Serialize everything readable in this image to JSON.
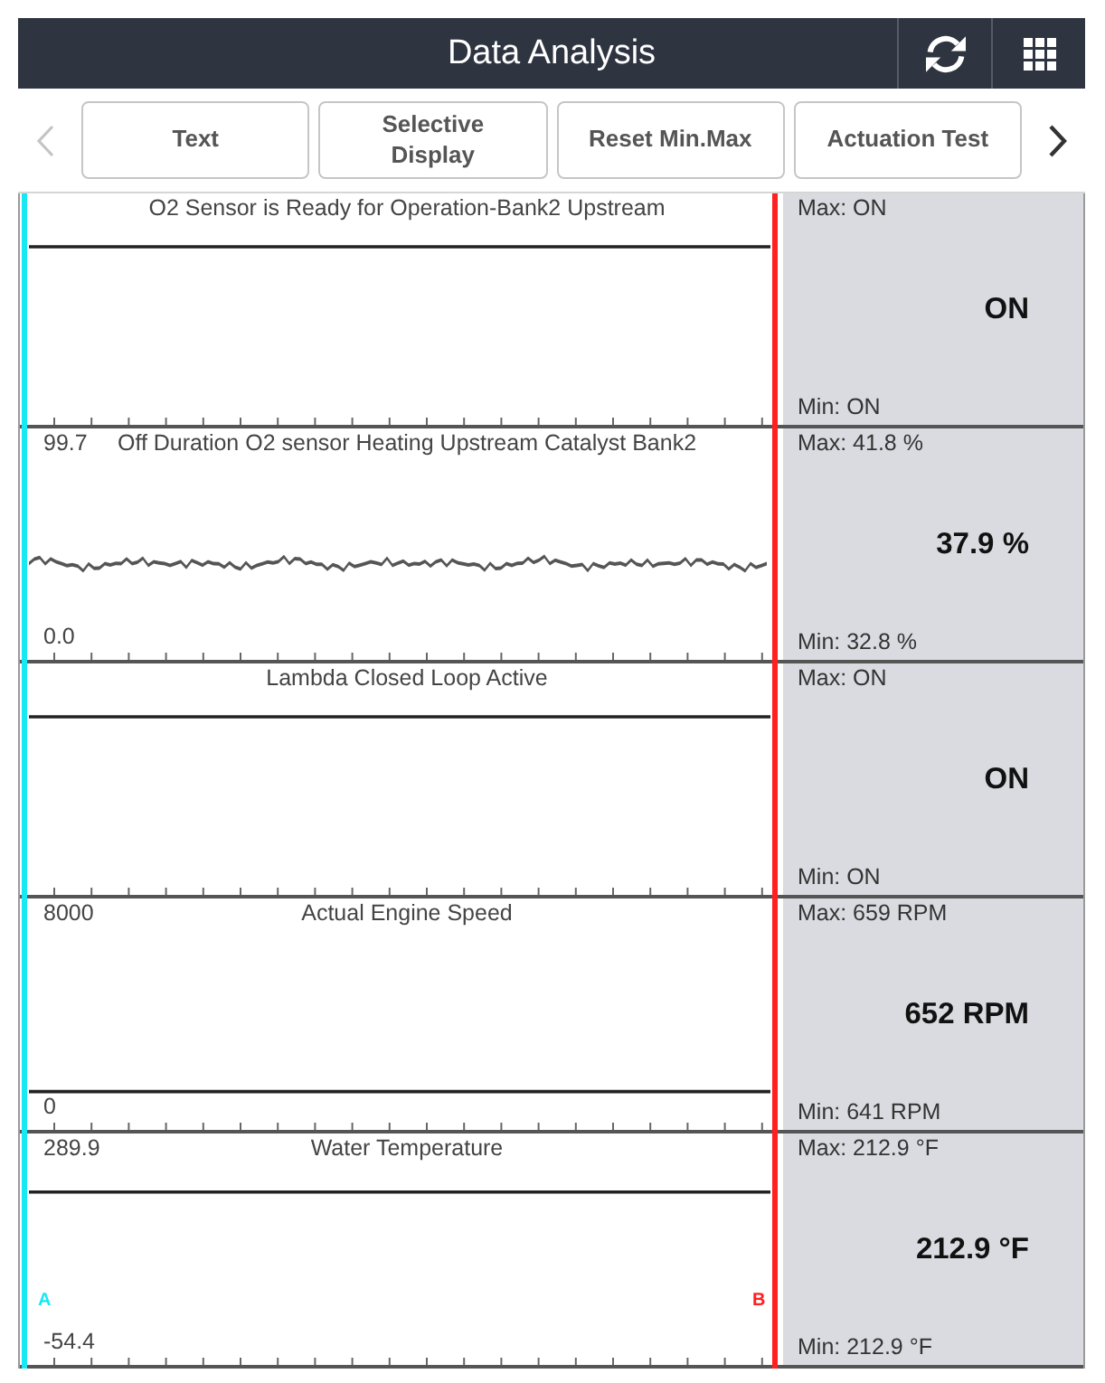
{
  "header": {
    "title": "Data Analysis"
  },
  "toolbar": {
    "scroll_prev": {
      "disabled": true
    },
    "scroll_next": {
      "disabled": false
    },
    "buttons": [
      {
        "label": "Text"
      },
      {
        "label": "Selective\nDisplay"
      },
      {
        "label": "Reset Min.Max"
      },
      {
        "label": "Actuation Test"
      }
    ]
  },
  "panels": [
    {
      "kind": "digital",
      "title": "O2 Sensor is Ready for Operation-Bank2 Upstream",
      "max": "Max: ON",
      "value": "ON",
      "min": "Min: ON"
    },
    {
      "kind": "waveform",
      "y_max": "99.7",
      "title": "Off Duration O2 sensor Heating Upstream Catalyst Bank2",
      "y_min": "0.0",
      "max": "Max: 41.8 %",
      "value": "37.9 %",
      "min": "Min: 32.8 %"
    },
    {
      "kind": "digital",
      "title": "Lambda Closed Loop Active",
      "max": "Max: ON",
      "value": "ON",
      "min": "Min: ON"
    },
    {
      "kind": "analog",
      "y_max": "8000",
      "title": "Actual Engine Speed",
      "y_min": "0",
      "max": "Max: 659 RPM",
      "value": "652 RPM",
      "min": "Min: 641 RPM"
    },
    {
      "kind": "analog",
      "y_max": "289.9",
      "title": "Water Temperature",
      "y_min": "-54.4",
      "max": "Max: 212.9 °F",
      "value": "212.9 °F",
      "min": "Min: 212.9 °F"
    }
  ],
  "cursors": [
    {
      "label": "A",
      "color": "#18e8f4"
    },
    {
      "label": "B",
      "color": "#ff2020"
    }
  ]
}
